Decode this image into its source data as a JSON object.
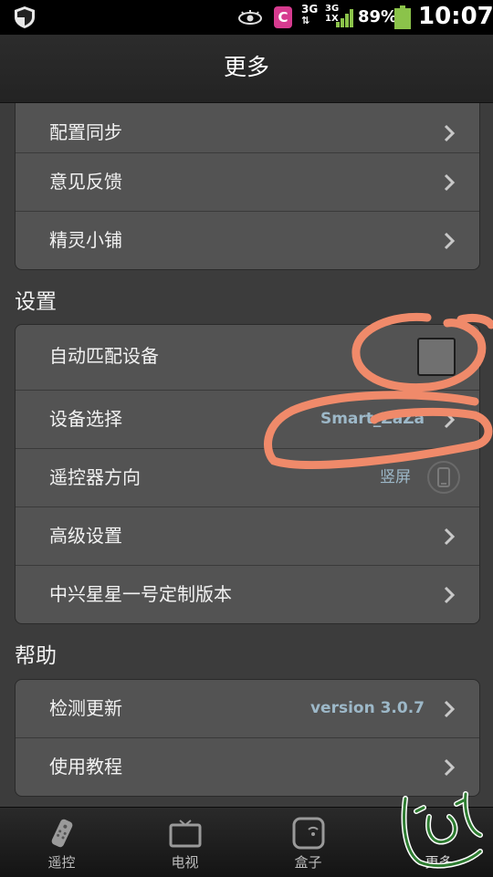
{
  "status_bar": {
    "network_label": "3G",
    "network_label_2": "3G",
    "network_sub": "1X",
    "app_badge": "C",
    "battery": "89%",
    "time": "10:07"
  },
  "header": {
    "title": "更多"
  },
  "group1": {
    "items": [
      {
        "label": "配置同步"
      },
      {
        "label": "意见反馈"
      },
      {
        "label": "精灵小铺"
      }
    ]
  },
  "settings": {
    "title": "设置",
    "items": [
      {
        "label": "自动匹配设备"
      },
      {
        "label": "设备选择",
        "value": "Smart_ZaZa"
      },
      {
        "label": "遥控器方向",
        "value": "竖屏"
      },
      {
        "label": "高级设置"
      },
      {
        "label": "中兴星星一号定制版本"
      }
    ]
  },
  "help": {
    "title": "帮助",
    "items": [
      {
        "label": "检测更新",
        "value": "version 3.0.7"
      },
      {
        "label": "使用教程"
      }
    ]
  },
  "tabs": [
    {
      "label": "遥控",
      "icon": "remote-icon"
    },
    {
      "label": "电视",
      "icon": "tv-icon"
    },
    {
      "label": "盒子",
      "icon": "box-icon"
    },
    {
      "label": "更多",
      "icon": "more-icon"
    }
  ],
  "colors": {
    "accent_value": "#9db8c8",
    "annotation": "#f08060"
  }
}
